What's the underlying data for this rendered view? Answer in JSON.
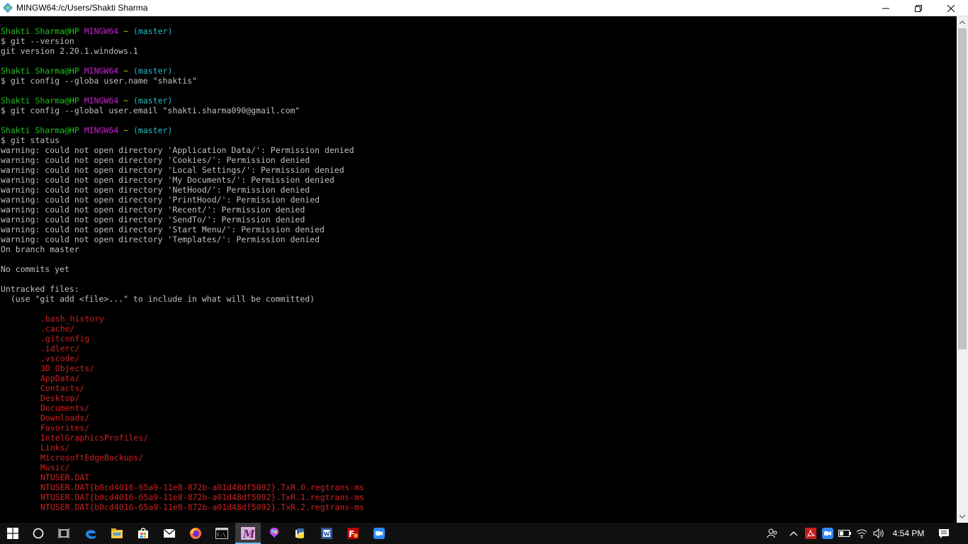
{
  "window": {
    "title": "MINGW64:/c/Users/Shakti Sharma"
  },
  "colors": {
    "prompt_user": "#1fbf1f",
    "prompt_shell": "#c123c6",
    "prompt_path": "#c0c000",
    "prompt_branch": "#2bbac5",
    "untracked": "#d21f1f",
    "output": "#c0c0c0"
  },
  "terminal": {
    "lines": [
      {
        "type": "prompt",
        "user": "Shakti Sharma@HP",
        "shell": "MINGW64",
        "path": "~",
        "branch": "(master)"
      },
      {
        "type": "text",
        "text": "$ git --version"
      },
      {
        "type": "text",
        "text": "git version 2.20.1.windows.1"
      },
      {
        "type": "blank"
      },
      {
        "type": "prompt",
        "user": "Shakti Sharma@HP",
        "shell": "MINGW64",
        "path": "~",
        "branch": "(master)"
      },
      {
        "type": "text",
        "text": "$ git config --globa user.name \"shaktis\""
      },
      {
        "type": "blank"
      },
      {
        "type": "prompt",
        "user": "Shakti Sharma@HP",
        "shell": "MINGW64",
        "path": "~",
        "branch": "(master)"
      },
      {
        "type": "text",
        "text": "$ git config --global user.email \"shakti.sharma090@gmail.com\""
      },
      {
        "type": "blank"
      },
      {
        "type": "prompt",
        "user": "Shakti Sharma@HP",
        "shell": "MINGW64",
        "path": "~",
        "branch": "(master)"
      },
      {
        "type": "text",
        "text": "$ git status"
      },
      {
        "type": "text",
        "text": "warning: could not open directory 'Application Data/': Permission denied"
      },
      {
        "type": "text",
        "text": "warning: could not open directory 'Cookies/': Permission denied"
      },
      {
        "type": "text",
        "text": "warning: could not open directory 'Local Settings/': Permission denied"
      },
      {
        "type": "text",
        "text": "warning: could not open directory 'My Documents/': Permission denied"
      },
      {
        "type": "text",
        "text": "warning: could not open directory 'NetHood/': Permission denied"
      },
      {
        "type": "text",
        "text": "warning: could not open directory 'PrintHood/': Permission denied"
      },
      {
        "type": "text",
        "text": "warning: could not open directory 'Recent/': Permission denied"
      },
      {
        "type": "text",
        "text": "warning: could not open directory 'SendTo/': Permission denied"
      },
      {
        "type": "text",
        "text": "warning: could not open directory 'Start Menu/': Permission denied"
      },
      {
        "type": "text",
        "text": "warning: could not open directory 'Templates/': Permission denied"
      },
      {
        "type": "text",
        "text": "On branch master"
      },
      {
        "type": "blank"
      },
      {
        "type": "text",
        "text": "No commits yet"
      },
      {
        "type": "blank"
      },
      {
        "type": "text",
        "text": "Untracked files:"
      },
      {
        "type": "text",
        "text": "  (use \"git add <file>...\" to include in what will be committed)"
      },
      {
        "type": "blank"
      },
      {
        "type": "untracked",
        "text": ".bash_history"
      },
      {
        "type": "untracked",
        "text": ".cache/"
      },
      {
        "type": "untracked",
        "text": ".gitconfig"
      },
      {
        "type": "untracked",
        "text": ".idlerc/"
      },
      {
        "type": "untracked",
        "text": ".vscode/"
      },
      {
        "type": "untracked",
        "text": "3D Objects/"
      },
      {
        "type": "untracked",
        "text": "AppData/"
      },
      {
        "type": "untracked",
        "text": "Contacts/"
      },
      {
        "type": "untracked",
        "text": "Desktop/"
      },
      {
        "type": "untracked",
        "text": "Documents/"
      },
      {
        "type": "untracked",
        "text": "Downloads/"
      },
      {
        "type": "untracked",
        "text": "Favorites/"
      },
      {
        "type": "untracked",
        "text": "IntelGraphicsProfiles/"
      },
      {
        "type": "untracked",
        "text": "Links/"
      },
      {
        "type": "untracked",
        "text": "MicrosoftEdgeBackups/"
      },
      {
        "type": "untracked",
        "text": "Music/"
      },
      {
        "type": "untracked",
        "text": "NTUSER.DAT"
      },
      {
        "type": "untracked",
        "text": "NTUSER.DAT{b0cd4016-65a9-11e8-872b-a01d48df5092}.TxR.0.regtrans-ms"
      },
      {
        "type": "untracked",
        "text": "NTUSER.DAT{b0cd4016-65a9-11e8-872b-a01d48df5092}.TxR.1.regtrans-ms"
      },
      {
        "type": "untracked",
        "text": "NTUSER.DAT{b0cd4016-65a9-11e8-872b-a01d48df5092}.TxR.2.regtrans-ms"
      }
    ]
  },
  "taskbar": {
    "apps": [
      {
        "name": "windows-start-icon",
        "active": false
      },
      {
        "name": "cortana-search-icon",
        "active": false
      },
      {
        "name": "task-view-icon",
        "active": false
      },
      {
        "name": "edge-icon",
        "active": false
      },
      {
        "name": "file-explorer-icon",
        "active": false
      },
      {
        "name": "store-icon",
        "active": false
      },
      {
        "name": "mail-icon",
        "active": false
      },
      {
        "name": "firefox-icon",
        "active": false
      },
      {
        "name": "command-prompt-icon",
        "active": false
      },
      {
        "name": "mingw64-icon",
        "active": true
      },
      {
        "name": "paint3d-icon",
        "active": false
      },
      {
        "name": "python-idle-icon",
        "active": false
      },
      {
        "name": "writer-icon",
        "active": false
      },
      {
        "name": "filezilla-icon",
        "active": false
      },
      {
        "name": "zoom-icon",
        "active": false
      }
    ],
    "clock": "4:54 PM"
  }
}
